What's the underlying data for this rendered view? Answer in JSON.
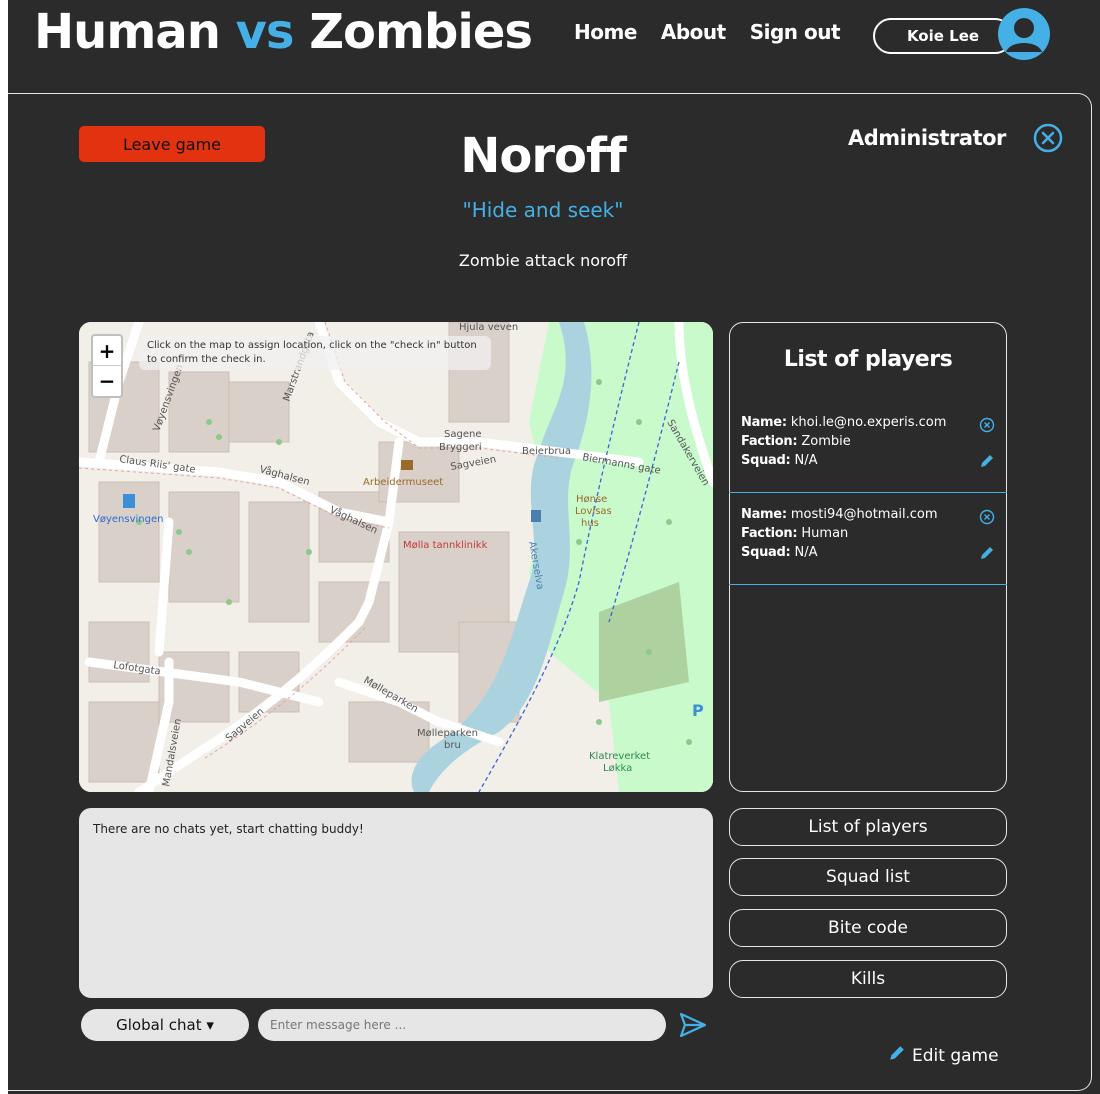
{
  "header": {
    "brand_part1": "Human ",
    "brand_vs": "vs",
    "brand_part2": " Zombies",
    "nav": [
      "Home",
      "About",
      "Sign out"
    ],
    "user_name": "Koie Lee",
    "avatar_icon": "user-circle-icon"
  },
  "game": {
    "leave_label": "Leave game",
    "title": "Noroff",
    "subtitle": "\"Hide and seek\"",
    "description": "Zombie attack noroff",
    "role": "Administrator"
  },
  "map": {
    "hint": "Click on the map to assign location, click on the \"check in\" button to confirm the check in.",
    "zoom_in": "+",
    "zoom_out": "−",
    "labels": [
      "Hjula veven",
      "Claus Riis' gate",
      "Våghalsen",
      "Sagene Bryggeri",
      "Sagveien",
      "Arbeidermuseet",
      "Beierbrua",
      "Biermanns gate",
      "Sandakerveien",
      "Vøyensvingen",
      "Møllа tannklinikk",
      "Hønse Lovisas hus",
      "Akerselva",
      "Lofotgata",
      "Mølleparken",
      "Mølleparken bru",
      "Mandalsveien",
      "Klatreverket Løkka",
      "Marstrandgata"
    ]
  },
  "players": {
    "title": "List of players",
    "items": [
      {
        "name_label": "Name:",
        "name": "khoi.le@no.experis.com",
        "faction_label": "Faction:",
        "faction": "Zombie",
        "squad_label": "Squad:",
        "squad": "N/A"
      },
      {
        "name_label": "Name:",
        "name": "mosti94@hotmail.com",
        "faction_label": "Faction:",
        "faction": "Human",
        "squad_label": "Squad:",
        "squad": "N/A"
      }
    ]
  },
  "chat": {
    "empty_text": "There are no chats yet, start chatting buddy!",
    "channel": "Global chat ▾",
    "placeholder": "Enter message here ..."
  },
  "side_buttons": [
    "List of players",
    "Squad list",
    "Bite code",
    "Kills"
  ],
  "edit_game_label": "Edit game",
  "colors": {
    "accent": "#45b0e6",
    "danger": "#e2320f",
    "background": "#2b2b2b"
  }
}
